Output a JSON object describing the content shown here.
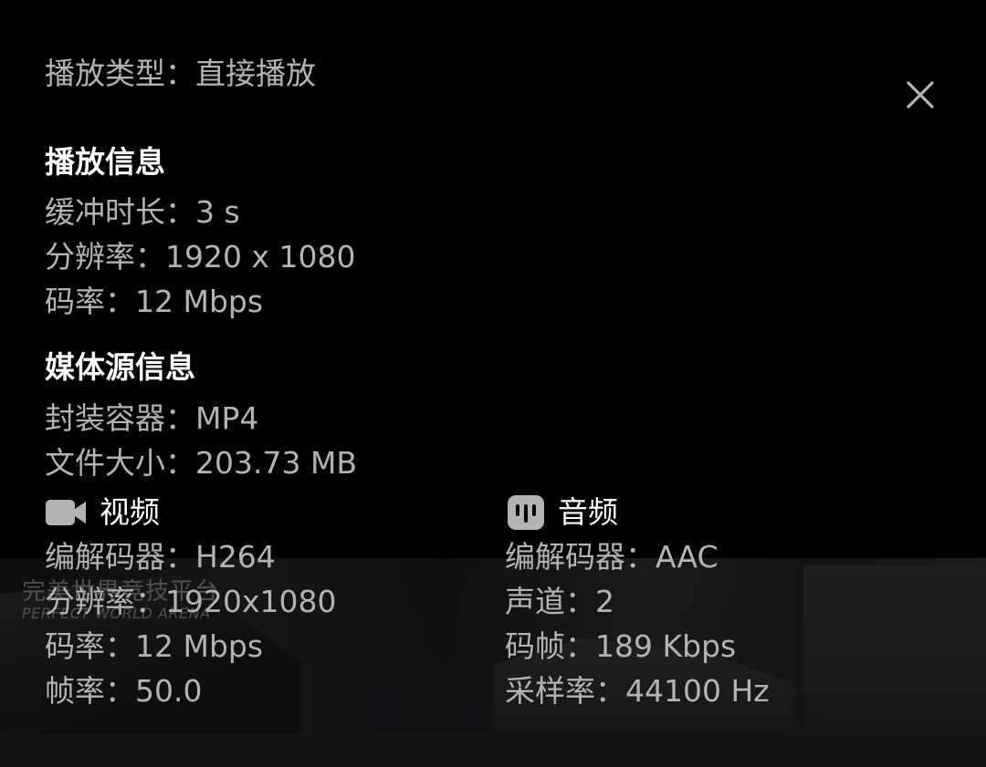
{
  "playback_type": {
    "label": "播放类型",
    "value": "直接播放"
  },
  "playback_info": {
    "title": "播放信息",
    "items": [
      {
        "label": "缓冲时长",
        "value": "3 s"
      },
      {
        "label": "分辨率",
        "value": "1920 x 1080"
      },
      {
        "label": "码率",
        "value": "12 Mbps"
      }
    ]
  },
  "media_source": {
    "title": "媒体源信息",
    "items": [
      {
        "label": "封装容器",
        "value": "MP4"
      },
      {
        "label": "文件大小",
        "value": "203.73 MB"
      }
    ]
  },
  "video": {
    "title": "视频",
    "icon": "video-camera-icon",
    "items": [
      {
        "label": "编解码器",
        "value": "H264"
      },
      {
        "label": "分辨率",
        "value": "1920x1080"
      },
      {
        "label": "码率",
        "value": "12 Mbps"
      },
      {
        "label": "帧率",
        "value": "50.0"
      }
    ]
  },
  "audio": {
    "title": "音频",
    "icon": "audio-waveform-icon",
    "items": [
      {
        "label": "编解码器",
        "value": "AAC"
      },
      {
        "label": "声道",
        "value": "2"
      },
      {
        "label": "码帧",
        "value": "189 Kbps"
      },
      {
        "label": "采样率",
        "value": "44100 Hz"
      }
    ]
  },
  "watermark": {
    "cn": "完美世界竞技平台",
    "en": "PERFECT WORLD ARENA"
  },
  "colors": {
    "background": "#000000",
    "label_text": "#b3b3b3",
    "heading_text": "#ffffff",
    "icon": "#b3b3b3"
  },
  "close_icon": "close-icon",
  "separator": "："
}
